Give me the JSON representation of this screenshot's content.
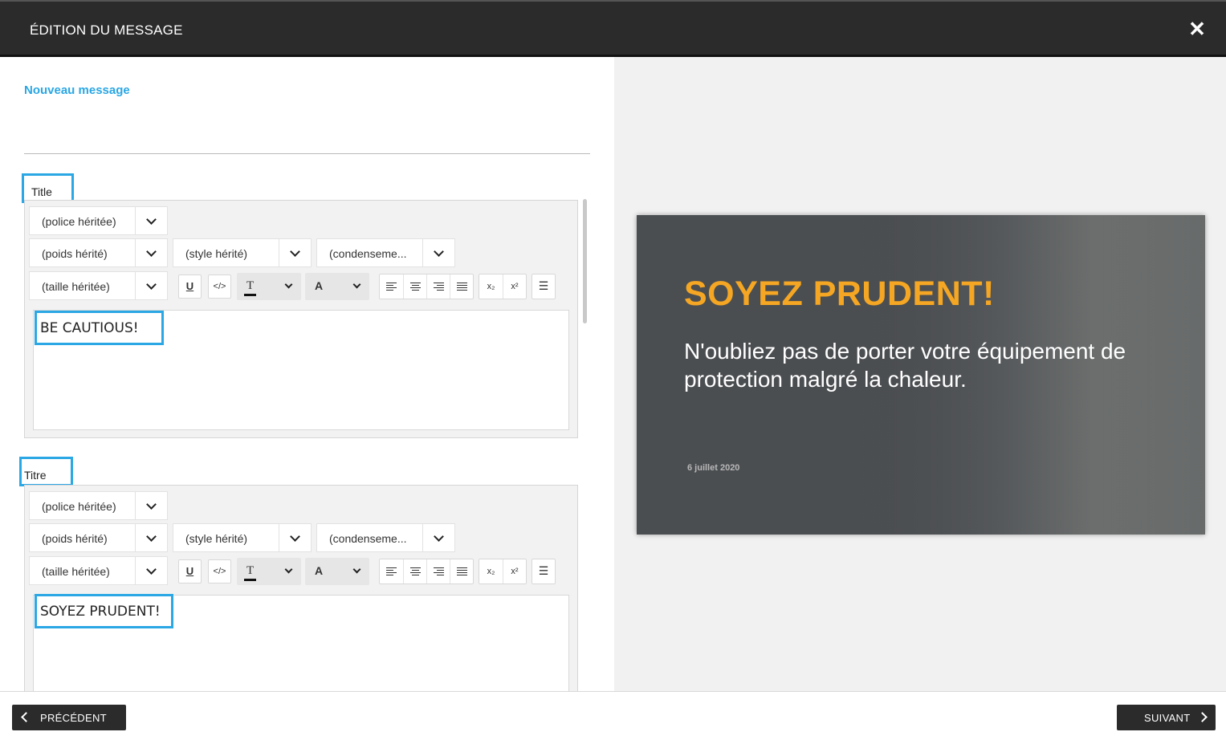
{
  "header": {
    "title": "ÉDITION DU MESSAGE",
    "close_icon": "close-icon"
  },
  "form": {
    "section_title": "Nouveau message",
    "fields": [
      {
        "label": "Title",
        "font": "(police héritée)",
        "weight": "(poids hérité)",
        "style": "(style hérité)",
        "condensed": "(condenseme...",
        "size": "(taille héritée)",
        "value": "BE CAUTIOUS!"
      },
      {
        "label": "Titre",
        "font": "(police héritée)",
        "weight": "(poids hérité)",
        "style": "(style hérité)",
        "condensed": "(condenseme...",
        "size": "(taille héritée)",
        "value": "SOYEZ PRUDENT!"
      }
    ],
    "toolbar": {
      "underline": "U",
      "code": "</>",
      "text_color": "T",
      "bg_color": "A",
      "subscript": "x₂",
      "superscript": "x²"
    }
  },
  "preview": {
    "title": "SOYEZ PRUDENT!",
    "subtitle": "N'oubliez pas de porter votre équipement de protection malgré la chaleur.",
    "date": "6 juillet 2020",
    "title_color": "#f5a623"
  },
  "footer": {
    "prev_label": "PRÉCÉDENT",
    "next_label": "SUIVANT"
  },
  "colors": {
    "accent": "#2aa7e4",
    "header_bg": "#2b2b2b"
  }
}
